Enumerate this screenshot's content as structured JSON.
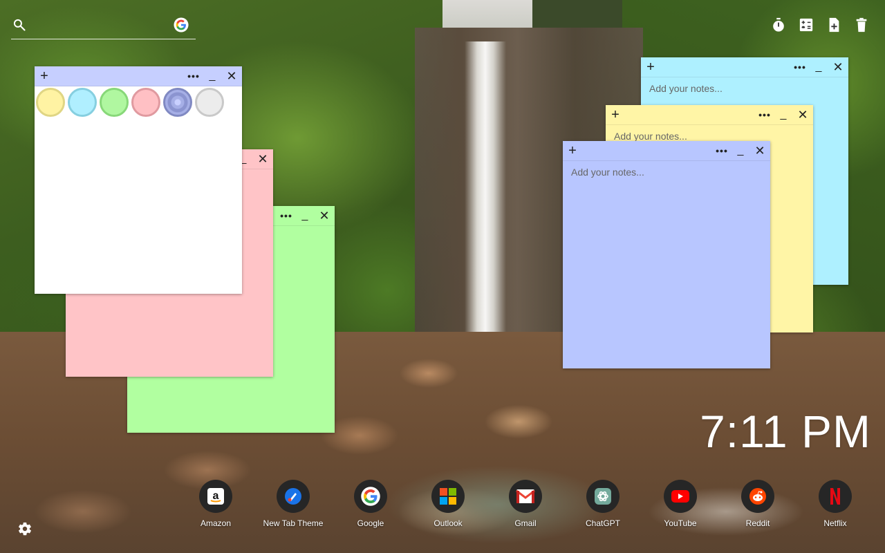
{
  "search": {
    "placeholder": "",
    "icon": "search-icon",
    "engine_icon": "google-icon"
  },
  "toolbar": {
    "items": [
      {
        "name": "timer",
        "icon": "stopwatch-icon"
      },
      {
        "name": "calculator",
        "icon": "calculator-icon"
      },
      {
        "name": "new-note",
        "icon": "add-note-icon"
      },
      {
        "name": "delete",
        "icon": "trash-icon"
      }
    ]
  },
  "notes": [
    {
      "id": "note-green",
      "color": "#b1ffa0",
      "placeholder": ""
    },
    {
      "id": "note-pink",
      "color": "#ffc4c7",
      "placeholder": ""
    },
    {
      "id": "note-white",
      "color": "#ffffff",
      "bar_color": "#c6cfff",
      "placeholder": ""
    },
    {
      "id": "note-cyan",
      "color": "#aef0ff",
      "placeholder": "Add your notes..."
    },
    {
      "id": "note-yellow",
      "color": "#fff5a6",
      "placeholder": "Add your notes..."
    },
    {
      "id": "note-blue",
      "color": "#b8c6ff",
      "placeholder": "Add your notes..."
    }
  ],
  "note_controls": {
    "add": "+",
    "menu": "•••",
    "minimize": "_",
    "close": "✕"
  },
  "palette": [
    {
      "name": "yellow",
      "fill": "#fff3a3",
      "border": "#e0d684"
    },
    {
      "name": "cyan",
      "fill": "#b0efff",
      "border": "#86cfe0"
    },
    {
      "name": "green",
      "fill": "#b0f7a0",
      "border": "#88d879"
    },
    {
      "name": "pink",
      "fill": "#ffc0c4",
      "border": "#e09aa0"
    },
    {
      "name": "blue",
      "fill": "#a6afe6",
      "border": "#8089c2",
      "selected": true
    },
    {
      "name": "gray",
      "fill": "#ececec",
      "border": "#c9c9c9"
    }
  ],
  "clock": {
    "time": "7:11 PM"
  },
  "shortcuts": [
    {
      "label": "Amazon",
      "icon": "amazon-icon"
    },
    {
      "label": "New Tab Theme",
      "icon": "new-tab-theme-icon"
    },
    {
      "label": "Google",
      "icon": "google-icon"
    },
    {
      "label": "Outlook",
      "icon": "outlook-icon"
    },
    {
      "label": "Gmail",
      "icon": "gmail-icon"
    },
    {
      "label": "ChatGPT",
      "icon": "chatgpt-icon"
    },
    {
      "label": "YouTube",
      "icon": "youtube-icon"
    },
    {
      "label": "Reddit",
      "icon": "reddit-icon"
    },
    {
      "label": "Netflix",
      "icon": "netflix-icon"
    }
  ],
  "settings": {
    "icon": "gear-icon"
  }
}
